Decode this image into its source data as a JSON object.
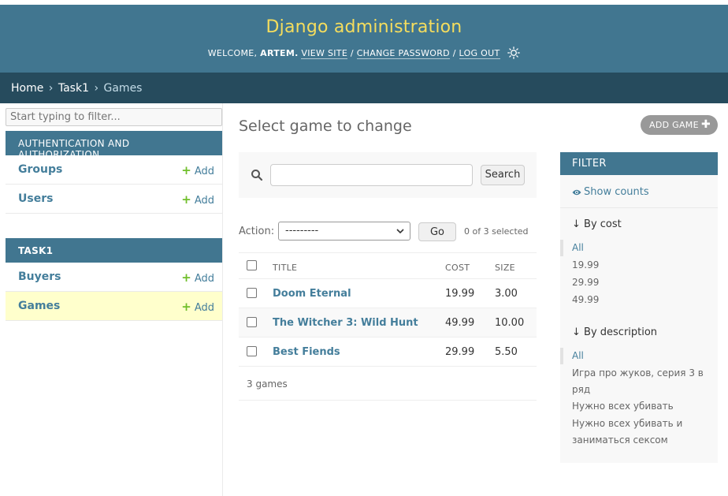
{
  "header": {
    "branding": "Django administration",
    "welcome": "Welcome,",
    "username": "artem.",
    "view_site": "View site",
    "change_password": "Change password",
    "log_out": "Log out",
    "separator": "/",
    "brand_color": "#f5dd5d",
    "bar_color": "#417690"
  },
  "breadcrumbs": {
    "home": "Home",
    "app": "Task1",
    "current": "Games",
    "sep": "›"
  },
  "sidebar": {
    "filter_placeholder": "Start typing to filter...",
    "apps": [
      {
        "caption": "AUTHENTICATION AND AUTHORIZATION",
        "models": [
          {
            "name": "Groups",
            "add": "Add"
          },
          {
            "name": "Users",
            "add": "Add"
          }
        ]
      },
      {
        "caption": "TASK1",
        "models": [
          {
            "name": "Buyers",
            "add": "Add"
          },
          {
            "name": "Games",
            "add": "Add"
          }
        ]
      }
    ]
  },
  "content": {
    "title": "Select game to change",
    "add_button": "ADD GAME",
    "search": {
      "value": "",
      "button": "Search"
    },
    "actions": {
      "label": "Action:",
      "selected_option": "---------",
      "go": "Go",
      "counter": "0 of 3 selected"
    },
    "table": {
      "columns": [
        "TITLE",
        "COST",
        "SIZE"
      ],
      "rows": [
        {
          "title": "Doom Eternal",
          "cost": "19.99",
          "size": "3.00"
        },
        {
          "title": "The Witcher 3: Wild Hunt",
          "cost": "49.99",
          "size": "10.00"
        },
        {
          "title": "Best Fiends",
          "cost": "29.99",
          "size": "5.50"
        }
      ]
    },
    "paginator": "3 games"
  },
  "filter": {
    "header": "FILTER",
    "show_counts": "Show counts",
    "groups": [
      {
        "title": "↓ By cost",
        "options": [
          "All",
          "19.99",
          "29.99",
          "49.99"
        ]
      },
      {
        "title": "↓ By description",
        "options": [
          "All",
          "Игра про жуков, серия 3 в ряд",
          "Нужно всех убивать",
          "Нужно всех убивать и заниматься сексом"
        ]
      }
    ]
  }
}
